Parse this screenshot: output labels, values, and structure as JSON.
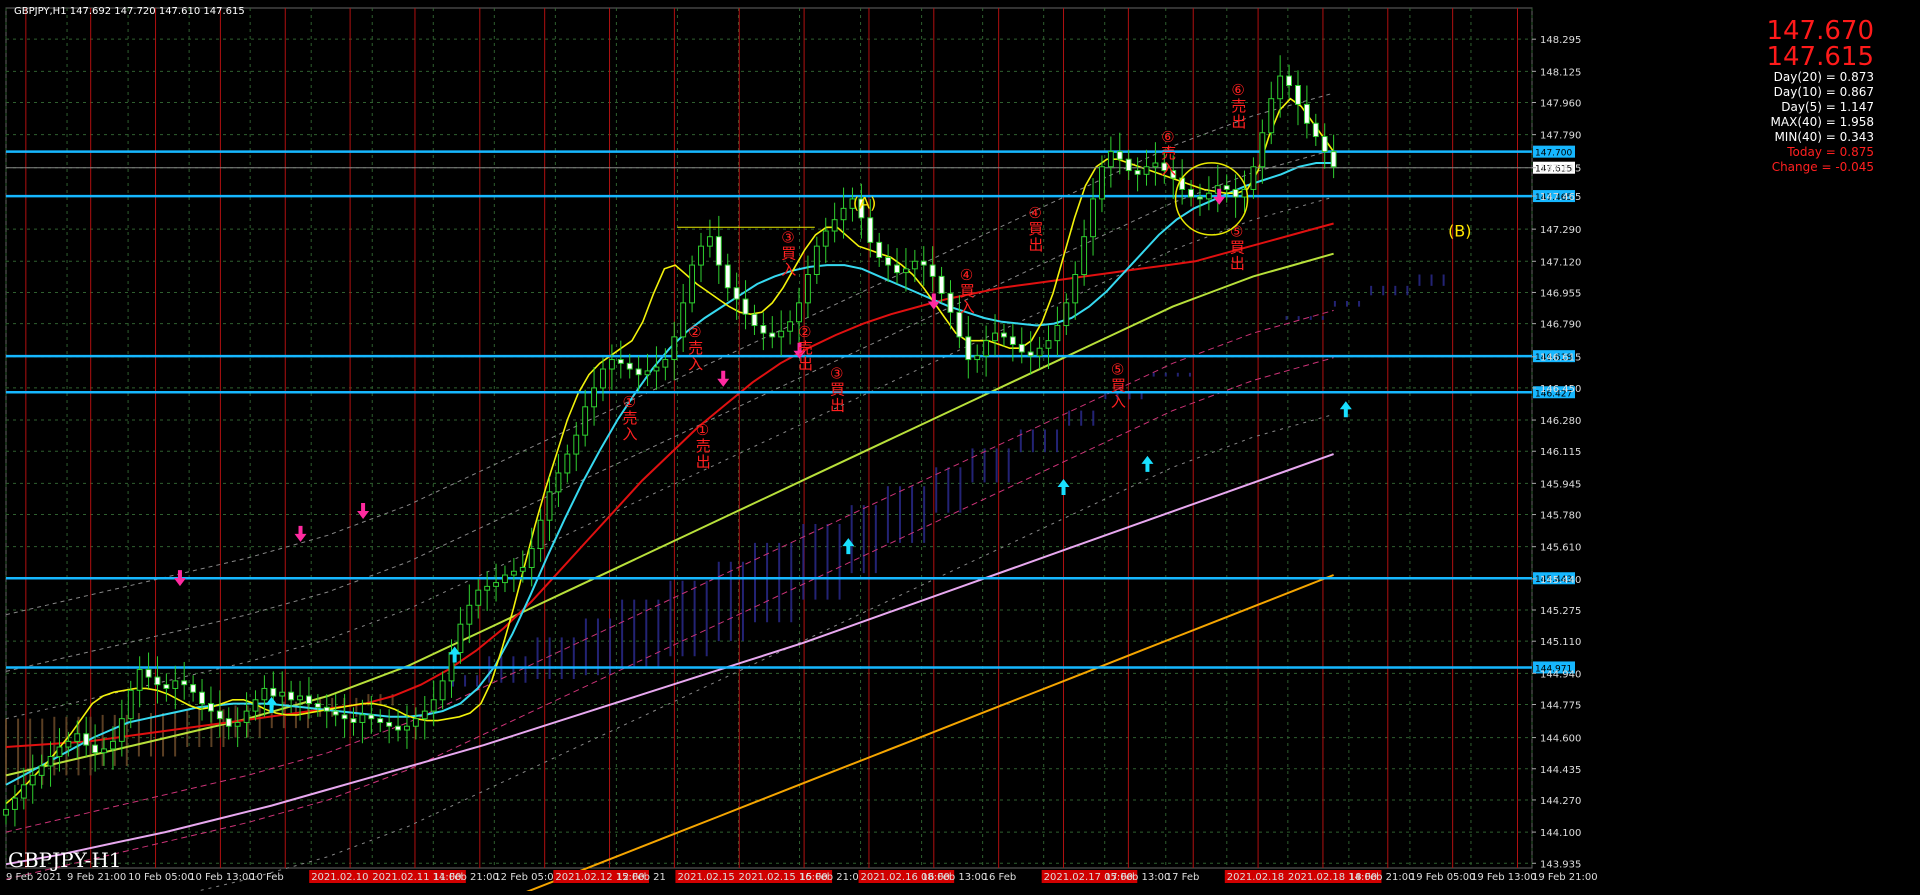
{
  "header": {
    "symbol_timeframe": "GBPJPY,H1",
    "ohlc": "147.692 147.720 147.610 147.615"
  },
  "watermark": "GBPJPY-H1",
  "stats": {
    "price_1": "147.670",
    "price_2": "147.615",
    "rows": [
      {
        "text": "Day(20) = 0.873",
        "red": false
      },
      {
        "text": "Day(10) = 0.867",
        "red": false
      },
      {
        "text": "Day(5) = 1.147",
        "red": false
      },
      {
        "text": "MAX(40) = 1.958",
        "red": false
      },
      {
        "text": "MIN(40) = 0.343",
        "red": false
      },
      {
        "text": "Today = 0.875",
        "red": true
      },
      {
        "text": "Change = -0.045",
        "red": true
      }
    ]
  },
  "chart_data": {
    "type": "line",
    "title": "GBPJPY,H1",
    "ylim": [
      143.91,
      148.46
    ],
    "price_ticks": [
      "148.295",
      "148.125",
      "147.960",
      "147.790",
      "147.615",
      "147.465",
      "147.290",
      "147.120",
      "146.955",
      "146.790",
      "146.615",
      "146.450",
      "146.280",
      "146.115",
      "145.945",
      "145.780",
      "145.610",
      "145.440",
      "145.275",
      "145.110",
      "144.940",
      "144.775",
      "144.600",
      "144.435",
      "144.270",
      "144.100",
      "143.935"
    ],
    "x_ticks": [
      "9 Feb 2021",
      "9 Feb 21:00",
      "10 Feb 05:00",
      "10 Feb 13:00",
      "10 Feb",
      "2021.02.10 05:00",
      "2021.02.11 14:00",
      "11 Feb 21:00",
      "12 Feb 05:00",
      "2021.02.12 15:00",
      "12 Feb 21",
      "2021.02.15 07:00",
      "2021.02.15 16:00",
      "15 Feb 21:00",
      "2021.02.16 08:00",
      "16 Feb 13:00",
      "16 Feb",
      "2021.02.17 05:00",
      "17 Feb 13:00",
      "17 Feb",
      "2021.02.18 05:00",
      "2021.02.18 14:00",
      "18 Feb 21:00",
      "19 Feb 05:00",
      "19 Feb 13:00",
      "19 Feb 21:00"
    ],
    "horizontal_levels": [
      {
        "price": 147.7,
        "label": "147.700"
      },
      {
        "price": 147.465,
        "label": "147.465"
      },
      {
        "price": 146.618,
        "label": "146.618"
      },
      {
        "price": 146.427,
        "label": "146.427"
      },
      {
        "price": 145.443,
        "label": "145.443"
      },
      {
        "price": 144.971,
        "label": "144.971"
      }
    ],
    "current_price_label": "147.615",
    "closes": [
      144.22,
      144.28,
      144.35,
      144.4,
      144.45,
      144.5,
      144.55,
      144.58,
      144.62,
      144.56,
      144.52,
      144.54,
      144.58,
      144.7,
      144.85,
      144.96,
      144.92,
      144.88,
      144.86,
      144.9,
      144.88,
      144.84,
      144.78,
      144.74,
      144.7,
      144.66,
      144.68,
      144.74,
      144.8,
      144.86,
      144.82,
      144.84,
      144.8,
      144.82,
      144.78,
      144.76,
      144.74,
      144.72,
      144.7,
      144.68,
      144.72,
      144.7,
      144.68,
      144.66,
      144.64,
      144.66,
      144.7,
      144.74,
      144.8,
      144.9,
      145.05,
      145.2,
      145.3,
      145.38,
      145.4,
      145.42,
      145.46,
      145.48,
      145.5,
      145.6,
      145.75,
      145.9,
      146.0,
      146.1,
      146.2,
      146.35,
      146.45,
      146.55,
      146.6,
      146.58,
      146.55,
      146.52,
      146.54,
      146.56,
      146.6,
      146.72,
      146.9,
      147.1,
      147.2,
      147.25,
      147.1,
      146.98,
      146.92,
      146.84,
      146.78,
      146.74,
      146.72,
      146.75,
      146.8,
      146.9,
      147.05,
      147.2,
      147.28,
      147.34,
      147.4,
      147.45,
      147.35,
      147.22,
      147.14,
      147.1,
      147.06,
      147.08,
      147.12,
      147.1,
      147.04,
      146.95,
      146.85,
      146.72,
      146.6,
      146.62,
      146.7,
      146.74,
      146.72,
      146.68,
      146.64,
      146.62,
      146.66,
      146.7,
      146.78,
      146.9,
      147.05,
      147.25,
      147.45,
      147.62,
      147.7,
      147.66,
      147.6,
      147.58,
      147.62,
      147.64,
      147.6,
      147.56,
      147.5,
      147.46,
      147.45,
      147.48,
      147.52,
      147.5,
      147.46,
      147.5,
      147.62,
      147.8,
      147.98,
      148.1,
      148.05,
      147.95,
      147.85,
      147.78,
      147.7,
      147.62
    ],
    "ema_fast": [
      144.25,
      144.3,
      144.36,
      144.42,
      144.48,
      144.55,
      144.62,
      144.7,
      144.78,
      144.82,
      144.84,
      144.85,
      144.86,
      144.86,
      144.85,
      144.83,
      144.8,
      144.77,
      144.75,
      144.76,
      144.78,
      144.8,
      144.8,
      144.78,
      144.75,
      144.73,
      144.72,
      144.72,
      144.73,
      144.74,
      144.75,
      144.76,
      144.77,
      144.78,
      144.78,
      144.77,
      144.75,
      144.72,
      144.7,
      144.69,
      144.69,
      144.7,
      144.71,
      144.73,
      144.78,
      144.9,
      145.08,
      145.28,
      145.5,
      145.72,
      145.92,
      146.1,
      146.28,
      146.42,
      146.52,
      146.58,
      146.62,
      146.66,
      146.7,
      146.8,
      146.95,
      147.08,
      147.1,
      147.05,
      147.0,
      146.96,
      146.92,
      146.88,
      146.85,
      146.84,
      146.85,
      146.9,
      146.98,
      147.08,
      147.18,
      147.26,
      147.3,
      147.3,
      147.25,
      147.2,
      147.18,
      147.16,
      147.14,
      147.1,
      147.05,
      146.98,
      146.9,
      146.82,
      146.74,
      146.7,
      146.7,
      146.7,
      146.68,
      146.66,
      146.66,
      146.7,
      146.8,
      146.95,
      147.15,
      147.35,
      147.52,
      147.62,
      147.66,
      147.66,
      147.64,
      147.62,
      147.6,
      147.58,
      147.56,
      147.54,
      147.52,
      147.5,
      147.49,
      147.48,
      147.48,
      147.5,
      147.6,
      147.78,
      147.92,
      147.98,
      147.94,
      147.86,
      147.78,
      147.7
    ],
    "sma_mid": [
      144.35,
      144.4,
      144.45,
      144.5,
      144.55,
      144.6,
      144.64,
      144.68,
      144.7,
      144.72,
      144.74,
      144.76,
      144.77,
      144.78,
      144.78,
      144.78,
      144.77,
      144.76,
      144.75,
      144.74,
      144.73,
      144.72,
      144.71,
      144.71,
      144.72,
      144.74,
      144.78,
      144.86,
      144.98,
      145.15,
      145.35,
      145.56,
      145.76,
      145.95,
      146.12,
      146.28,
      146.42,
      146.55,
      146.66,
      146.75,
      146.82,
      146.88,
      146.94,
      147.0,
      147.04,
      147.07,
      147.09,
      147.1,
      147.1,
      147.08,
      147.04,
      147.0,
      146.96,
      146.92,
      146.88,
      146.85,
      146.82,
      146.8,
      146.79,
      146.78,
      146.79,
      146.82,
      146.88,
      146.96,
      147.06,
      147.16,
      147.26,
      147.34,
      147.4,
      147.44,
      147.48,
      147.52,
      147.55,
      147.58,
      147.62,
      147.64,
      147.64
    ],
    "sma_slow": [
      144.55,
      144.56,
      144.57,
      144.58,
      144.6,
      144.62,
      144.64,
      144.66,
      144.68,
      144.7,
      144.72,
      144.74,
      144.76,
      144.78,
      144.82,
      144.88,
      144.96,
      145.06,
      145.18,
      145.32,
      145.48,
      145.64,
      145.8,
      145.96,
      146.1,
      146.24,
      146.36,
      146.48,
      146.58,
      146.66,
      146.73,
      146.79,
      146.84,
      146.88,
      146.92,
      146.95,
      146.98,
      147.0,
      147.02,
      147.04,
      147.06,
      147.08,
      147.1,
      147.12,
      147.16,
      147.2,
      147.24,
      147.28,
      147.32
    ],
    "sma_long": [
      144.4,
      144.45,
      144.5,
      144.55,
      144.6,
      144.65,
      144.7,
      144.76,
      144.82,
      144.9,
      144.98,
      145.08,
      145.18,
      145.28,
      145.38,
      145.48,
      145.58,
      145.68,
      145.78,
      145.88,
      145.98,
      146.08,
      146.18,
      146.28,
      146.38,
      146.48,
      146.58,
      146.68,
      146.78,
      146.88,
      146.96,
      147.04,
      147.1,
      147.16
    ],
    "sma_200": [
      143.93,
      143.98,
      144.04,
      144.1,
      144.17,
      144.24,
      144.32,
      144.4,
      144.48,
      144.56,
      144.65,
      144.74,
      144.83,
      144.92,
      145.01,
      145.1,
      145.2,
      145.3,
      145.4,
      145.5,
      145.6,
      145.7,
      145.8,
      145.9,
      146.0,
      146.1
    ],
    "sma_400": [
      143.78,
      143.86,
      143.94,
      144.02,
      144.1,
      144.18,
      144.26,
      144.34,
      144.42,
      144.5,
      144.58,
      144.66,
      144.74,
      144.82,
      144.9,
      144.98,
      145.06,
      145.14,
      145.22,
      145.3,
      145.38,
      145.46
    ],
    "annotations": [
      {
        "text": "(A)",
        "color": "yellow",
        "price": 147.4,
        "slot": 0.555
      },
      {
        "text": "(B)",
        "color": "yellow",
        "price": 147.25,
        "slot": 0.945
      },
      {
        "text": "①売入",
        "color": "red",
        "price": 146.35,
        "slot": 0.404
      },
      {
        "text": "①売出",
        "color": "red",
        "price": 146.2,
        "slot": 0.452
      },
      {
        "text": "②売入",
        "color": "red",
        "price": 146.72,
        "slot": 0.447
      },
      {
        "text": "②売出",
        "color": "red",
        "price": 146.72,
        "slot": 0.519
      },
      {
        "text": "③買入",
        "color": "red",
        "price": 147.22,
        "slot": 0.508
      },
      {
        "text": "③買出",
        "color": "red",
        "price": 146.5,
        "slot": 0.54
      },
      {
        "text": "④買出",
        "color": "red",
        "price": 147.35,
        "slot": 0.67
      },
      {
        "text": "④買入",
        "color": "red",
        "price": 147.02,
        "slot": 0.625
      },
      {
        "text": "⑤買入",
        "color": "red",
        "price": 146.52,
        "slot": 0.724
      },
      {
        "text": "⑤買出",
        "color": "red",
        "price": 147.25,
        "slot": 0.802
      },
      {
        "text": "⑥売入",
        "color": "red",
        "price": 147.75,
        "slot": 0.757
      },
      {
        "text": "⑥売出",
        "color": "red",
        "price": 148.0,
        "slot": 0.803
      }
    ],
    "buy_arrows": [
      0.174,
      0.294,
      0.552,
      0.693,
      0.748,
      0.878
    ],
    "sell_arrows": [
      0.114,
      0.193,
      0.234,
      0.47,
      0.52,
      0.608,
      0.795
    ]
  }
}
